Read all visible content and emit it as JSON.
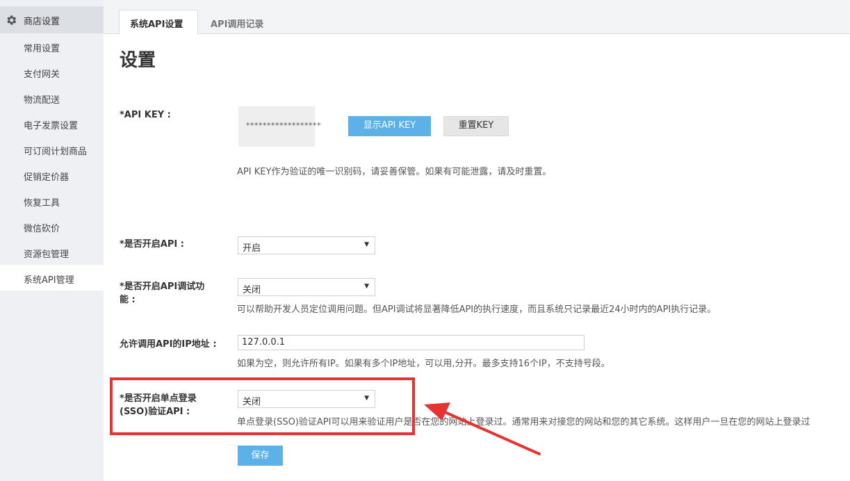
{
  "sidebar": {
    "header": "商店设置",
    "items": [
      {
        "label": "常用设置"
      },
      {
        "label": "支付网关"
      },
      {
        "label": "物流配送"
      },
      {
        "label": "电子发票设置"
      },
      {
        "label": "可订阅计划商品"
      },
      {
        "label": "促销定价器"
      },
      {
        "label": "恢复工具"
      },
      {
        "label": "微信砍价"
      },
      {
        "label": "资源包管理"
      },
      {
        "label": "系统API管理",
        "active": true
      }
    ]
  },
  "tabs": [
    {
      "label": "系统API设置",
      "active": true
    },
    {
      "label": "API调用记录",
      "active": false
    }
  ],
  "page_title": "设置",
  "api_key": {
    "label": "*API KEY :",
    "masked_value": "******************",
    "show_button": "显示API KEY",
    "reset_button": "重置KEY",
    "help": "API KEY作为验证的唯一识别码，请妥善保管。如果有可能泄露，请及时重置。"
  },
  "enable_api": {
    "label": "*是否开启API :",
    "value": "开启"
  },
  "debug_api": {
    "label_line1": "*是否开启API调试功",
    "label_line2": "能 :",
    "value": "关闭",
    "help": "可以帮助开发人员定位调用问题。但API调试将显著降低API的执行速度，而且系统只记录最近24小时内的API执行记录。"
  },
  "ip_whitelist": {
    "label": "允许调用API的IP地址 :",
    "value": "127.0.0.1",
    "help": "如果为空，则允许所有IP。如果有多个IP地址，可以用,分开。最多支持16个IP，不支持号段。"
  },
  "sso": {
    "label_line1": "*是否开启单点登录",
    "label_line2": "(SSO)验证API :",
    "value": "关闭",
    "help": "单点登录(SSO)验证API可以用来验证用户是否在您的网站上登录过。通常用来对接您的网站和您的其它系统。这样用户一旦在您的网站上登录过"
  },
  "save_button": "保存",
  "colors": {
    "accent_blue": "#5bb1e8",
    "annotation_red": "#e53333",
    "sidebar_bg": "#eef0f3"
  }
}
